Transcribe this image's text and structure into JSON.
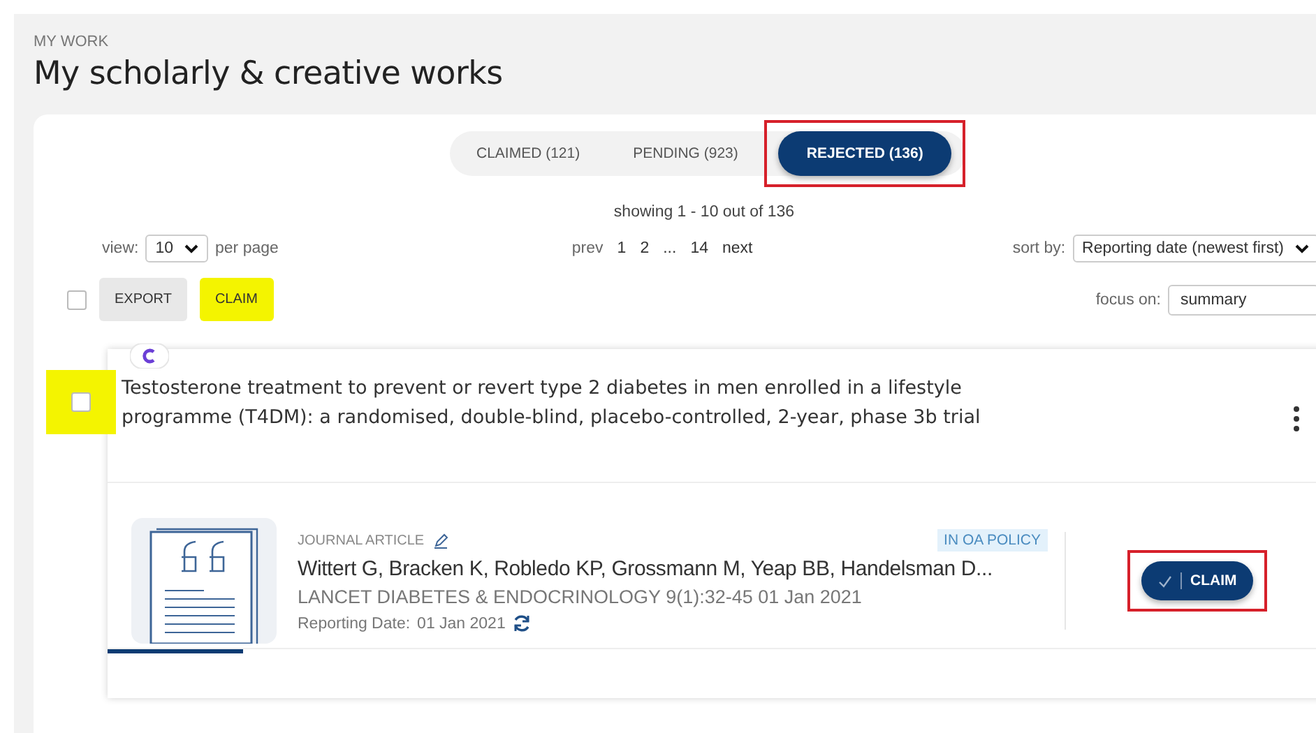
{
  "header": {
    "eyebrow": "MY WORK",
    "title": "My scholarly & creative works"
  },
  "tabs": [
    {
      "label": "CLAIMED (121)",
      "selected": false,
      "annotated": false
    },
    {
      "label": "PENDING (923)",
      "selected": false,
      "annotated": false
    },
    {
      "label": "REJECTED (136)",
      "selected": true,
      "annotated": true
    }
  ],
  "showing": "showing 1 - 10 out of 136",
  "view": {
    "label": "view:",
    "value": "10",
    "suffix": "per page"
  },
  "pagination": {
    "prev": "prev",
    "pages": [
      "1",
      "2",
      "...",
      "14"
    ],
    "next": "next"
  },
  "sort": {
    "label": "sort by:",
    "value": "Reporting date (newest first)"
  },
  "bulk": {
    "checked": false,
    "buttons": [
      {
        "label": "EXPORT",
        "highlighted": false
      },
      {
        "label": "CLAIM",
        "highlighted": true
      }
    ]
  },
  "focus": {
    "label": "focus on:",
    "value": "summary"
  },
  "work": {
    "checked": false,
    "highlighted": true,
    "title": "Testosterone treatment to prevent or revert type 2 diabetes in men enrolled in a lifestyle programme (T4DM): a randomised, double-blind, placebo-controlled, 2-year, phase 3b trial",
    "type": "JOURNAL ARTICLE",
    "badge": "IN OA POLICY",
    "authors": "Wittert G, Bracken K, Robledo KP, Grossmann M, Yeap BB, Handelsman D...",
    "source": "LANCET DIABETES & ENDOCRINOLOGY 9(1):32-45 01 Jan 2021",
    "date_label": "Reporting Date:",
    "date": "01 Jan 2021",
    "claim": {
      "label": "CLAIM",
      "annotated": true
    }
  }
}
